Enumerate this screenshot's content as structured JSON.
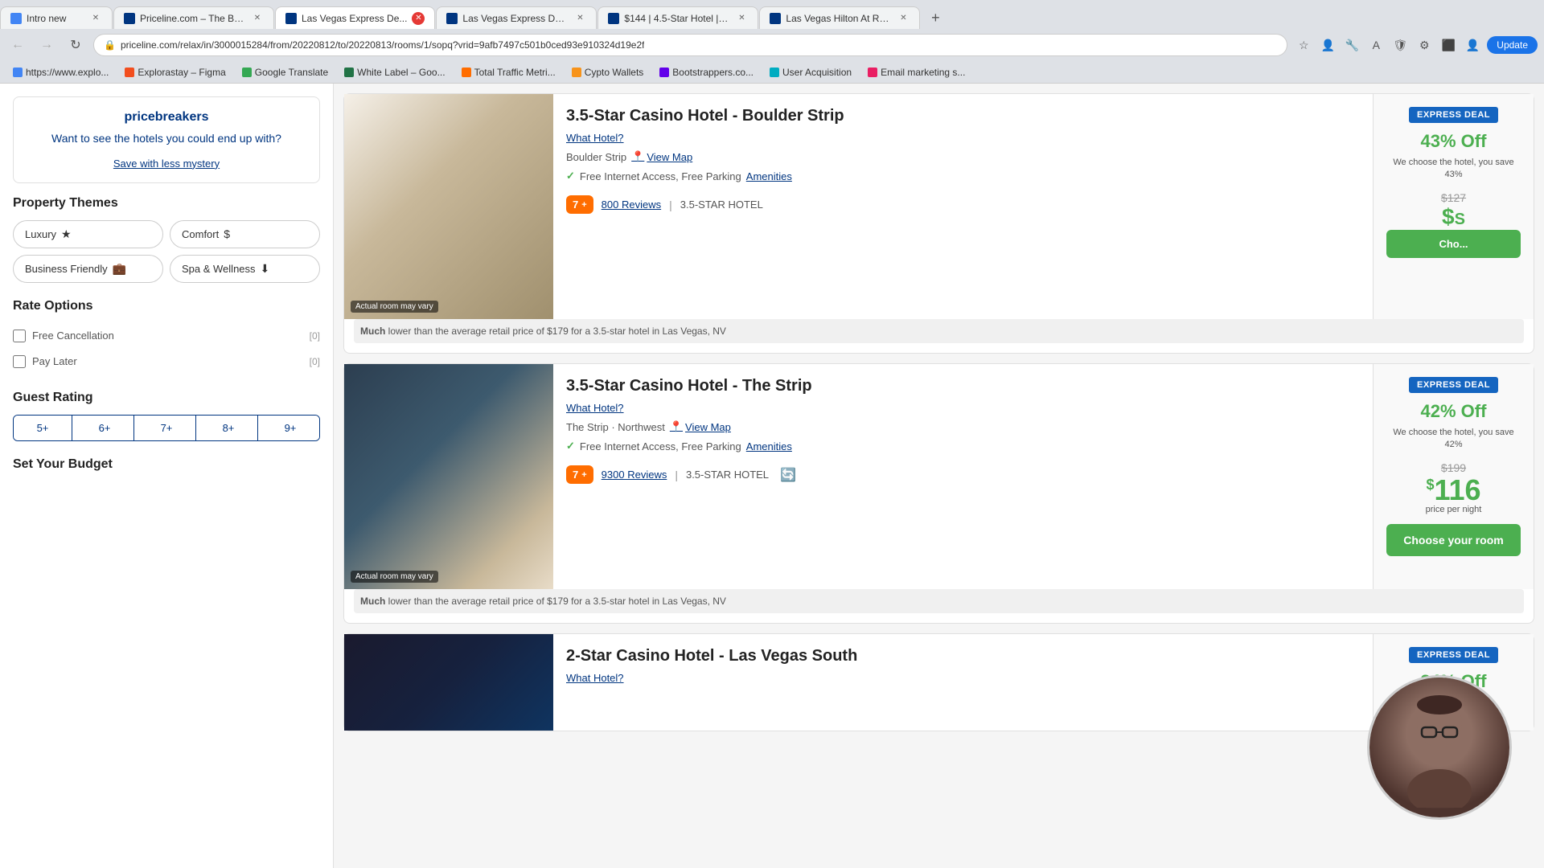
{
  "browser": {
    "tabs": [
      {
        "id": "tab1",
        "label": "Intro new",
        "active": false,
        "favicon_color": "blue"
      },
      {
        "id": "tab2",
        "label": "Priceline.com – The Best ...",
        "active": false,
        "favicon_color": "priceline"
      },
      {
        "id": "tab3",
        "label": "Las Vegas Express De...",
        "active": true,
        "favicon_color": "priceline"
      },
      {
        "id": "tab4",
        "label": "Las Vegas Express Deals:...",
        "active": false,
        "favicon_color": "priceline"
      },
      {
        "id": "tab5",
        "label": "$144 | 4.5-Star Hotel | Pri...",
        "active": false,
        "favicon_color": "priceline"
      },
      {
        "id": "tab6",
        "label": "Las Vegas Hilton At Resor...",
        "active": false,
        "favicon_color": "priceline"
      }
    ],
    "address": "priceline.com/relax/in/3000015284/from/20220812/to/20220813/rooms/1/sopq?vrid=9afb7497c501b0ced93e910324d19e2f",
    "update_btn": "Update"
  },
  "bookmarks": [
    {
      "label": "https://www.explo...",
      "icon": "bm-blue"
    },
    {
      "label": "Explorastay – Figma",
      "icon": "bm-figma"
    },
    {
      "label": "Google Translate",
      "icon": "bm-green"
    },
    {
      "label": "White Label – Goo...",
      "icon": "bm-office"
    },
    {
      "label": "Total Traffic Metri...",
      "icon": "bm-traffic"
    },
    {
      "label": "Cypto Wallets",
      "icon": "bm-crypto"
    },
    {
      "label": "Bootstrappers.co...",
      "icon": "bm-bs"
    },
    {
      "label": "User Acquisition",
      "icon": "bm-acquisition"
    },
    {
      "label": "Email marketing s...",
      "icon": "bm-email"
    }
  ],
  "sidebar": {
    "pricebreakers": {
      "title": "pricebreakers",
      "question": "Want to see the hotels you could end up with?",
      "save_link": "Save with less mystery"
    },
    "property_themes": {
      "title": "Property Themes",
      "themes": [
        {
          "label": "Luxury",
          "icon": "★"
        },
        {
          "label": "Comfort",
          "icon": "$"
        },
        {
          "label": "Business Friendly",
          "icon": "💼"
        },
        {
          "label": "Spa & Wellness",
          "icon": "⬇"
        }
      ]
    },
    "rate_options": {
      "title": "Rate Options",
      "options": [
        {
          "label": "Free Cancellation",
          "count": "[0]"
        },
        {
          "label": "Pay Later",
          "count": "[0]"
        }
      ]
    },
    "guest_rating": {
      "title": "Guest Rating",
      "ratings": [
        "5+",
        "6+",
        "7+",
        "8+",
        "9+"
      ]
    },
    "budget": {
      "title": "Set Your Budget"
    }
  },
  "hotels": [
    {
      "id": "hotel1",
      "title": "3.5-Star Casino Hotel - Boulder Strip",
      "what_hotel_label": "What Hotel?",
      "location": "Boulder Strip",
      "view_map": "View Map",
      "amenities": "Free Internet Access, Free Parking",
      "amenities_link": "Amenities",
      "rating_score": "7+",
      "reviews_count": "800 Reviews",
      "star_type": "3.5-STAR HOTEL",
      "express_deal": "EXPRESS DEAL",
      "discount_pct": "43% Off",
      "discount_desc": "We choose the hotel, you save 43%",
      "orig_price": "$127",
      "current_price": "",
      "price_per_night": "",
      "choose_btn": "Cho...",
      "price_note": "Much lower than the average retail price of $179 for a 3.5-star hotel in Las Vegas, NV",
      "image_class": "img-hotel-1"
    },
    {
      "id": "hotel2",
      "title": "3.5-Star Casino Hotel - The Strip",
      "what_hotel_label": "What Hotel?",
      "location": "The Strip · Northwest",
      "view_map": "View Map",
      "amenities": "Free Internet Access, Free Parking",
      "amenities_link": "Amenities",
      "rating_score": "7+",
      "reviews_count": "9300 Reviews",
      "star_type": "3.5-STAR HOTEL",
      "express_deal": "EXPRESS DEAL",
      "discount_pct": "42% Off",
      "discount_desc": "We choose the hotel, you save 42%",
      "orig_price": "$199",
      "current_price": "116",
      "price_per_night": "price per night",
      "choose_btn": "Choose your room",
      "price_note": "Much lower than the average retail price of $179 for a 3.5-star hotel in Las Vegas, NV",
      "image_class": "img-hotel-2"
    },
    {
      "id": "hotel3",
      "title": "2-Star Casino Hotel - Las Vegas South",
      "what_hotel_label": "What Hotel?",
      "location": "",
      "view_map": "",
      "amenities": "",
      "amenities_link": "",
      "rating_score": "",
      "reviews_count": "",
      "star_type": "",
      "express_deal": "EXPRESS DEAL",
      "discount_pct": "34% Off",
      "discount_desc": "",
      "orig_price": "",
      "current_price": "",
      "price_per_night": "",
      "choose_btn": "",
      "price_note": "",
      "image_class": "img-hotel-3"
    }
  ]
}
